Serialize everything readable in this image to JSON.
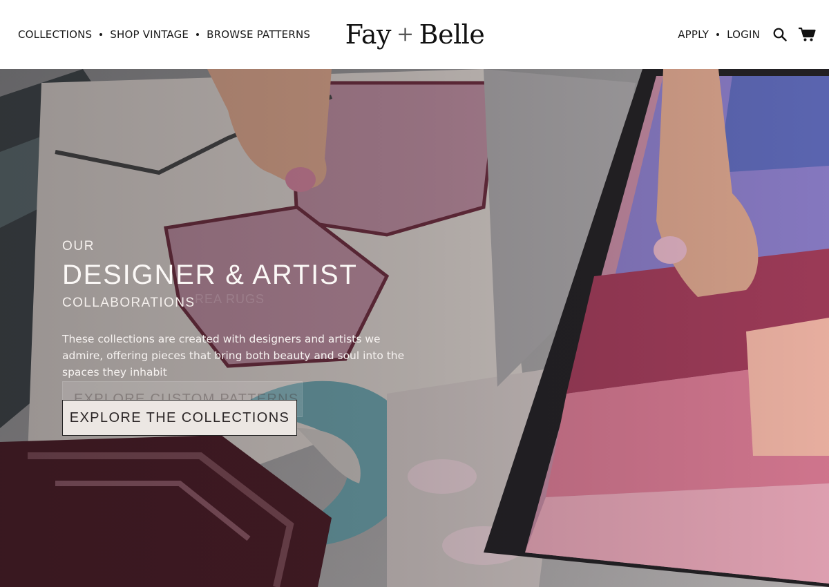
{
  "brand": {
    "name_left": "Fay",
    "name_plus": "+",
    "name_right": "Belle"
  },
  "header": {
    "left_nav": [
      {
        "label": "COLLECTIONS"
      },
      {
        "label": "SHOP VINTAGE"
      },
      {
        "label": "BROWSE PATTERNS"
      }
    ],
    "right_nav": [
      {
        "label": "APPLY"
      },
      {
        "label": "LOGIN"
      }
    ],
    "icons": {
      "search": "search-icon",
      "cart": "cart-icon"
    }
  },
  "hero": {
    "eyebrow": "OUR",
    "headline": "DESIGNER & ARTIST",
    "subline": "COLLABORATIONS",
    "body": "These collections are created with designers and artists we admire, offering pieces that bring both beauty and soul into the spaces they inhabit",
    "cta_label": "EXPLORE THE COLLECTIONS",
    "ghost_texts": {
      "area_rugs": "REA RUGS",
      "ghost_button": "EXPLORE CUSTOM PATTERNS"
    }
  },
  "colors": {
    "header_bg": "#ffffff",
    "text_dark": "#1a1a1a",
    "cta_bg": "#ece7e3",
    "hero_text": "#fbf8f6"
  }
}
